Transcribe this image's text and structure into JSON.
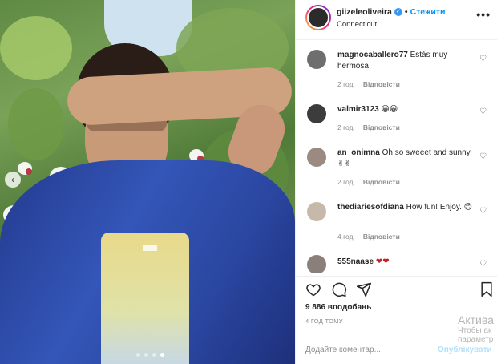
{
  "post": {
    "username": "giizeleoliveira",
    "separator": "•",
    "follow_label": "Стежити",
    "location": "Connecticut",
    "more_label": "•••",
    "verified_mark": "✓"
  },
  "comments": [
    {
      "user": "magnocaballero77",
      "text": "Estás muy hermosa",
      "time": "2 год.",
      "reply": "Відповісти",
      "avatar_color": "#6e6e6e"
    },
    {
      "user": "valmir3123",
      "text": "😁😁",
      "time": "2 год.",
      "reply": "Відповісти",
      "avatar_color": "#3c3c3c"
    },
    {
      "user": "an_onimna",
      "text": "Oh so sweeet and sunny✌✌",
      "time": "2 год.",
      "reply": "Відповісти",
      "avatar_color": "#9b8a80"
    },
    {
      "user": "thediariesofdiana",
      "text": "How fun! Enjoy. 😊",
      "time": "4 год.",
      "reply": "Відповісти",
      "avatar_color": "#c7b9aa"
    },
    {
      "user": "555naase",
      "text": "❤❤",
      "avatar_color": "#8a7f7a"
    }
  ],
  "stats": {
    "likes": "9 886 вподобань",
    "time_ago": "4 год тому"
  },
  "comment_box": {
    "placeholder": "Додайте коментар...",
    "publish_label": "Опублікувати"
  },
  "photo": {
    "carousel_dots": 4,
    "active_dot": 3
  },
  "watermark": {
    "line1": "Актива",
    "line2": "Чтобы ак",
    "line3": "параметр"
  }
}
